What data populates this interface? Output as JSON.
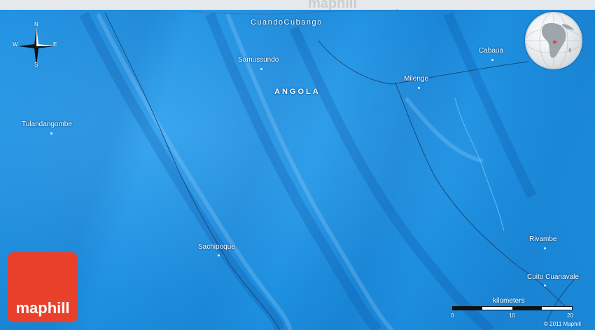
{
  "watermark": "maphill",
  "region_label": "CuandoCubango",
  "country_label": "ANGOLA",
  "places": [
    {
      "name": "Samussundo"
    },
    {
      "name": "Milenge"
    },
    {
      "name": "Cabaua"
    },
    {
      "name": "Tulandangombe"
    },
    {
      "name": "Sachipoque"
    },
    {
      "name": "Rivambe"
    },
    {
      "name": "Cuito Cuanavale"
    }
  ],
  "compass": {
    "north": "N",
    "south": "S",
    "east": "E",
    "west": "W"
  },
  "logo_text": "maphill",
  "scale": {
    "title": "kilometers",
    "ticks": [
      "0",
      "10",
      "20"
    ]
  },
  "copyright": "© 2011 Maphill",
  "colors": {
    "water_blue": "#2a9be8",
    "logo_red": "#e9402c",
    "topbar": "#e6eaed"
  }
}
